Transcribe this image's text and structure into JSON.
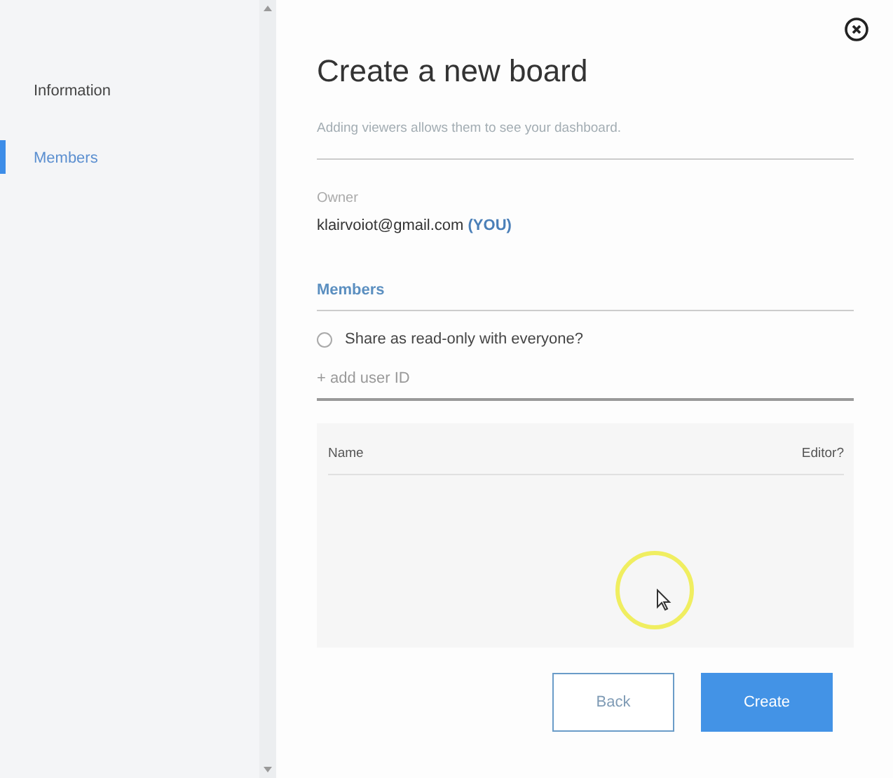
{
  "sidebar": {
    "items": [
      {
        "label": "Information",
        "selected": false
      },
      {
        "label": "Members",
        "selected": true
      }
    ]
  },
  "dialog": {
    "title": "Create a new board",
    "subtitle": "Adding viewers allows them to see your dashboard.",
    "owner_label": "Owner",
    "owner_email": "klairvoiot@gmail.com",
    "owner_tag": "(YOU)",
    "members_heading": "Members",
    "share_option": {
      "label": "Share as read-only with everyone?",
      "checked": false
    },
    "add_user": {
      "placeholder": "+ add user ID"
    },
    "table": {
      "columns": [
        "Name",
        "Editor?"
      ]
    },
    "buttons": [
      {
        "label": "Back",
        "kind": "secondary"
      },
      {
        "label": "Create",
        "kind": "primary"
      }
    ]
  }
}
